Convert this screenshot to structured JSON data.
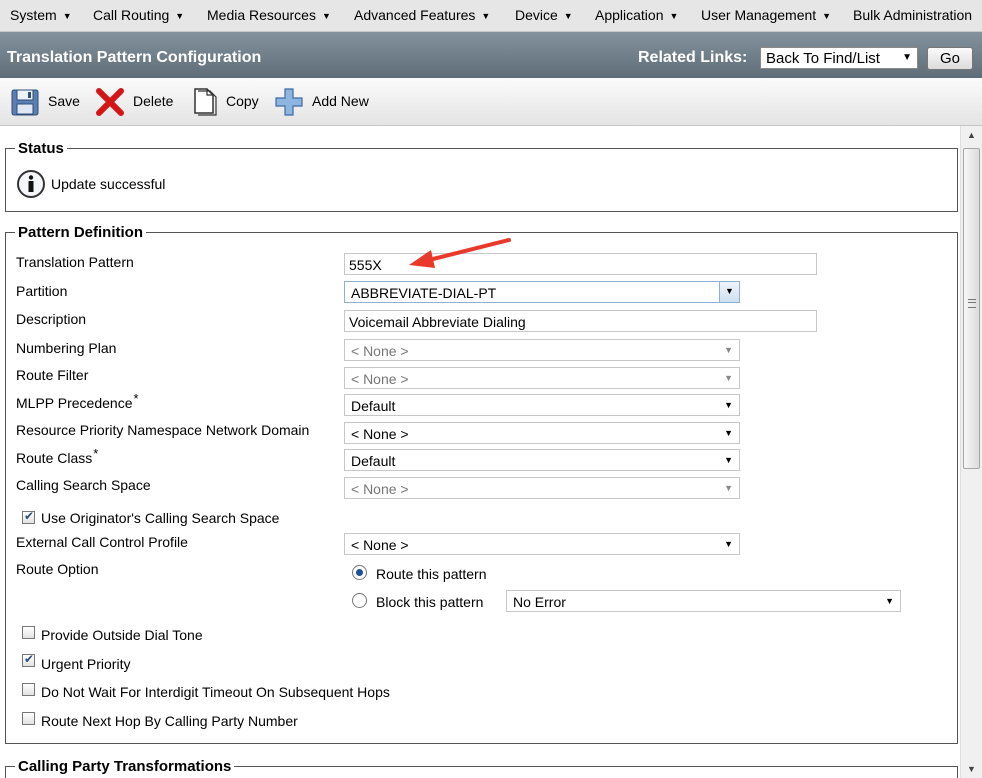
{
  "menu": {
    "items": [
      {
        "label": "System"
      },
      {
        "label": "Call Routing"
      },
      {
        "label": "Media Resources"
      },
      {
        "label": "Advanced Features"
      },
      {
        "label": "Device"
      },
      {
        "label": "Application"
      },
      {
        "label": "User Management"
      },
      {
        "label": "Bulk Administration"
      }
    ]
  },
  "header": {
    "title": "Translation Pattern Configuration",
    "related_links_label": "Related Links:",
    "related_links_value": "Back To Find/List",
    "go_label": "Go"
  },
  "toolbar": {
    "save_label": "Save",
    "delete_label": "Delete",
    "copy_label": "Copy",
    "add_new_label": "Add New"
  },
  "status": {
    "legend": "Status",
    "message": "Update successful",
    "icon": "info-icon"
  },
  "pattern_definition": {
    "legend": "Pattern Definition",
    "translation_pattern": {
      "label": "Translation Pattern",
      "value": "555X"
    },
    "partition": {
      "label": "Partition",
      "value": "ABBREVIATE-DIAL-PT"
    },
    "description": {
      "label": "Description",
      "value": "Voicemail Abbreviate Dialing"
    },
    "numbering_plan": {
      "label": "Numbering Plan",
      "value": "< None >"
    },
    "route_filter": {
      "label": "Route Filter",
      "value": "< None >"
    },
    "mlpp_precedence": {
      "label": "MLPP Precedence",
      "required": "*",
      "value": "Default"
    },
    "resource_priority": {
      "label": "Resource Priority Namespace Network Domain",
      "value": "< None >"
    },
    "route_class": {
      "label": "Route Class",
      "required": "*",
      "value": "Default"
    },
    "calling_search_space": {
      "label": "Calling Search Space",
      "value": "< None >"
    },
    "use_originators_css": {
      "label": "Use Originator's Calling Search Space",
      "checked": true
    },
    "external_call_control": {
      "label": "External Call Control Profile",
      "value": "< None >"
    },
    "route_option": {
      "label": "Route Option",
      "route_this": {
        "label": "Route this pattern",
        "selected": true
      },
      "block_this": {
        "label": "Block this pattern",
        "selected": false,
        "reason": "No Error"
      }
    },
    "provide_outside_dial_tone": {
      "label": "Provide Outside Dial Tone",
      "checked": false
    },
    "urgent_priority": {
      "label": "Urgent Priority",
      "checked": true
    },
    "do_not_wait": {
      "label": "Do Not Wait For Interdigit Timeout On Subsequent Hops",
      "checked": false
    },
    "route_next_hop": {
      "label": "Route Next Hop By Calling Party Number",
      "checked": false
    }
  },
  "calling_party": {
    "legend": "Calling Party Transformations"
  },
  "colors": {
    "title_bar": "#6f7d89",
    "annotation_arrow": "#e8392a"
  }
}
